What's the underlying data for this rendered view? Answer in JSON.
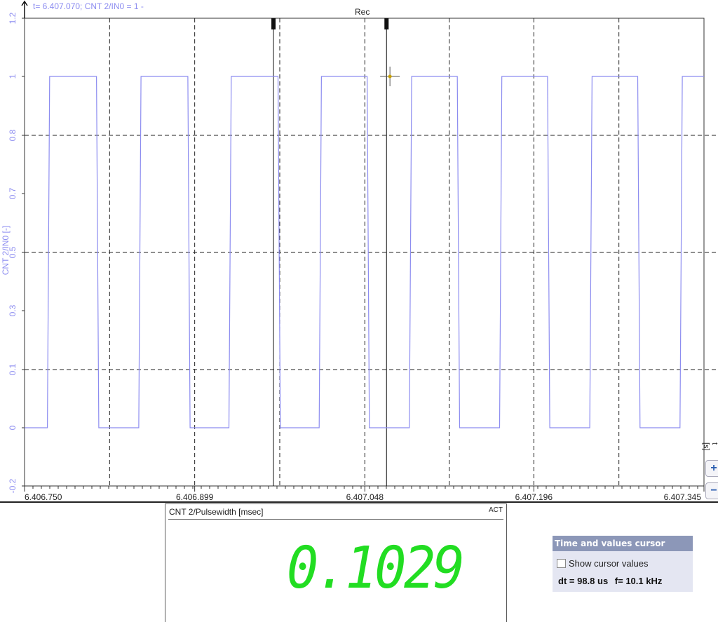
{
  "cursor_readout": "t= 6.407.070; CNT 2/IN0 = 1 -",
  "rec_label": "Rec",
  "x_unit": "t [s]",
  "zoom": {
    "in": "+",
    "out": "−"
  },
  "colors": {
    "signal": "#8c8cf0",
    "grid": "#222222",
    "digits": "#22dd22"
  },
  "chart_data": {
    "type": "line",
    "title": "",
    "xlabel": "t [s]",
    "ylabel": "CNT 2/IN0 [-]",
    "grid": true,
    "y_scale": "nonlinear (ticks labelled -0.2, 0, 0.1, 0.3, 0.5, 0.7, 0.8, 1, 1.2)",
    "y_tick_labels": [
      "-0.2",
      "0",
      "0.1",
      "0.3",
      "0.5",
      "0.7",
      "0.8",
      "1",
      "1.2"
    ],
    "x_tick_labels": [
      "6.406.750",
      "6.406.899",
      "6.407.048",
      "6.407.196",
      "6.407.345"
    ],
    "xlim": [
      "6.406.750",
      "6.407.345"
    ],
    "series": [
      {
        "name": "CNT 2/IN0",
        "points": [
          [
            "6.406.750",
            0
          ],
          [
            "6.406.770",
            0
          ],
          [
            "6.406.772",
            1
          ],
          [
            "6.406.813",
            1
          ],
          [
            "6.406.815",
            0
          ],
          [
            "6.406.850",
            0
          ],
          [
            "6.406.852",
            1
          ],
          [
            "6.406.893",
            1
          ],
          [
            "6.406.895",
            0
          ],
          [
            "6.406.929",
            0
          ],
          [
            "6.406.931",
            1
          ],
          [
            "6.406.972",
            1
          ],
          [
            "6.406.974",
            0
          ],
          [
            "6.407.008",
            0
          ],
          [
            "6.407.010",
            1
          ],
          [
            "6.407.050",
            1
          ],
          [
            "6.407.052",
            0
          ],
          [
            "6.407.087",
            0
          ],
          [
            "6.407.089",
            1
          ],
          [
            "6.407.129",
            1
          ],
          [
            "6.407.131",
            0
          ],
          [
            "6.407.166",
            0
          ],
          [
            "6.407.168",
            1
          ],
          [
            "6.407.208",
            1
          ],
          [
            "6.407.210",
            0
          ],
          [
            "6.407.245",
            0
          ],
          [
            "6.407.247",
            1
          ],
          [
            "6.407.287",
            1
          ],
          [
            "6.407.289",
            0
          ],
          [
            "6.407.324",
            0
          ],
          [
            "6.407.326",
            1
          ],
          [
            "6.407.345",
            1
          ]
        ]
      }
    ],
    "cursors": [
      "6.406.968",
      "6.407.067"
    ],
    "cursor_marker": {
      "x": "6.407.070",
      "y": 1
    }
  },
  "meter": {
    "title": "CNT 2/Pulsewidth [msec]",
    "status": "ACT",
    "value": "0.1029"
  },
  "cursor_box": {
    "title": "Time and values cursor",
    "checkbox_label": "Show cursor values",
    "dt": "dt = 98.8 us",
    "f": "f= 10.1 kHz"
  }
}
